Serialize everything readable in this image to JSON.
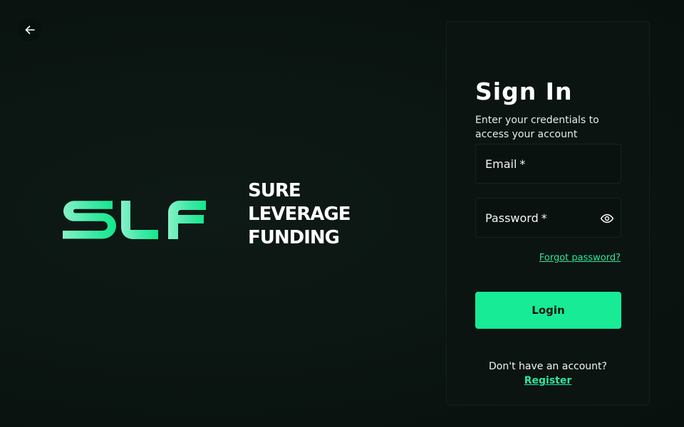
{
  "brand": {
    "logo_mark": "SLF",
    "name_lines": [
      "SURE",
      "LEVERAGE",
      "FUNDING"
    ],
    "accent_gradient": [
      "#7af0c2",
      "#19e88e"
    ]
  },
  "nav": {
    "back_icon": "arrow-left-icon"
  },
  "signin": {
    "title": "Sign In",
    "subtitle": "Enter your credentials to access your account",
    "email": {
      "label": "Email",
      "required_marker": "*",
      "value": ""
    },
    "password": {
      "label": "Password",
      "required_marker": "*",
      "value": "",
      "toggle_icon": "eye-icon"
    },
    "forgot_label": "Forgot password?",
    "login_label": "Login",
    "no_account_text": "Don't have an account?",
    "register_label": "Register"
  },
  "colors": {
    "accent": "#17eb95",
    "link": "#2ee59d",
    "background": "#0b1512",
    "card": "#0b1411"
  }
}
